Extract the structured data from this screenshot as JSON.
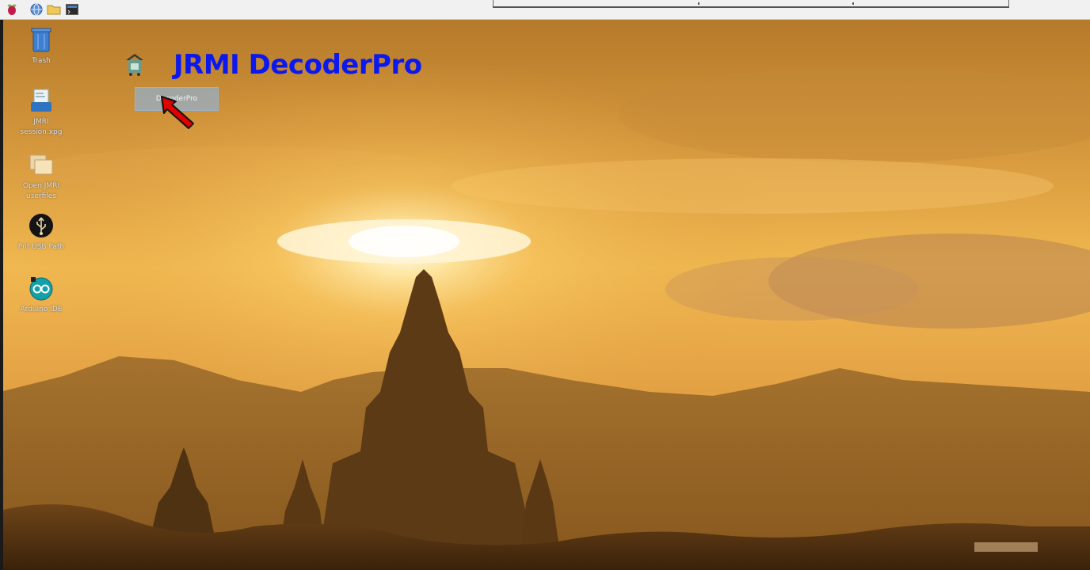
{
  "taskbar": {
    "menu_icon": "raspberry-menu-icon",
    "web_icon": "web-browser-icon",
    "files_icon": "file-manager-icon",
    "terminal_icon": "terminal-icon"
  },
  "desktop": {
    "icons": [
      {
        "label": "Trash",
        "icon": "trash-icon"
      },
      {
        "label": "JMRI\nsession.xpg",
        "icon": "document-icon"
      },
      {
        "label": "Open JMRI\nuserfiles",
        "icon": "folder-icon"
      },
      {
        "label": "Pnt USB Path",
        "icon": "usb-icon"
      },
      {
        "label": "Arduino IDE",
        "icon": "arduino-icon"
      }
    ],
    "decoderpro": {
      "icon": "decoderpro-icon",
      "label": "DecoderPro"
    }
  },
  "annotation": {
    "title": "JRMI DecoderPro",
    "title_color": "#0b18ee",
    "arrow_color": "#e00000"
  }
}
